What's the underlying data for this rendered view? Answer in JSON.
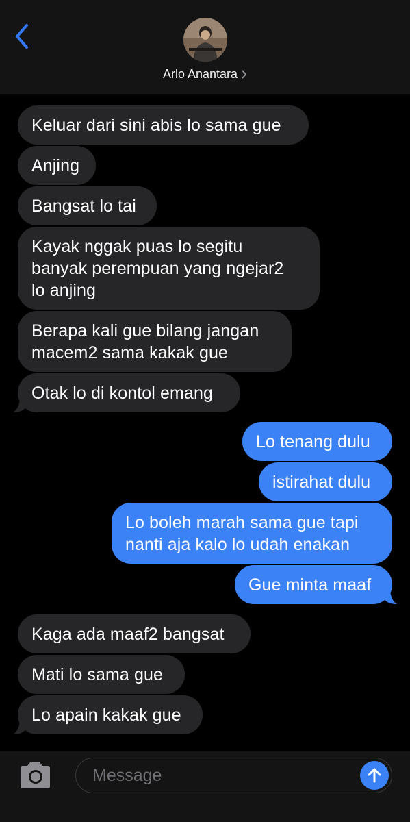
{
  "header": {
    "contact_name": "Arlo Anantara",
    "back_icon": "chevron-left-icon",
    "detail_icon": "chevron-right-icon"
  },
  "colors": {
    "incoming_bubble": "#262628",
    "outgoing_bubble": "#3b82f6",
    "accent": "#3478f6"
  },
  "messages": [
    {
      "direction": "in",
      "lines": [
        "Keluar dari sini abis lo sama gue"
      ]
    },
    {
      "direction": "in",
      "lines": [
        "Anjing"
      ]
    },
    {
      "direction": "in",
      "lines": [
        "Bangsat lo tai"
      ]
    },
    {
      "direction": "in",
      "lines": [
        "Kayak nggak puas lo segitu",
        "banyak perempuan yang ngejar2",
        "lo anjing"
      ]
    },
    {
      "direction": "in",
      "lines": [
        "Berapa kali gue bilang jangan",
        "macem2 sama kakak gue"
      ]
    },
    {
      "direction": "in",
      "lines": [
        "Otak lo di kontol emang"
      ]
    },
    {
      "direction": "out",
      "lines": [
        "Lo tenang dulu"
      ]
    },
    {
      "direction": "out",
      "lines": [
        "istirahat dulu"
      ]
    },
    {
      "direction": "out",
      "lines": [
        "Lo boleh marah sama gue tapi",
        "nanti aja kalo lo udah enakan"
      ]
    },
    {
      "direction": "out",
      "lines": [
        "Gue minta maaf"
      ]
    },
    {
      "direction": "in",
      "lines": [
        "Kaga ada maaf2 bangsat"
      ]
    },
    {
      "direction": "in",
      "lines": [
        "Mati lo sama gue"
      ]
    },
    {
      "direction": "in",
      "lines": [
        "Lo apain kakak gue"
      ]
    }
  ],
  "composer": {
    "placeholder": "Message",
    "camera_icon": "camera-icon",
    "send_icon": "send-arrow-icon"
  }
}
